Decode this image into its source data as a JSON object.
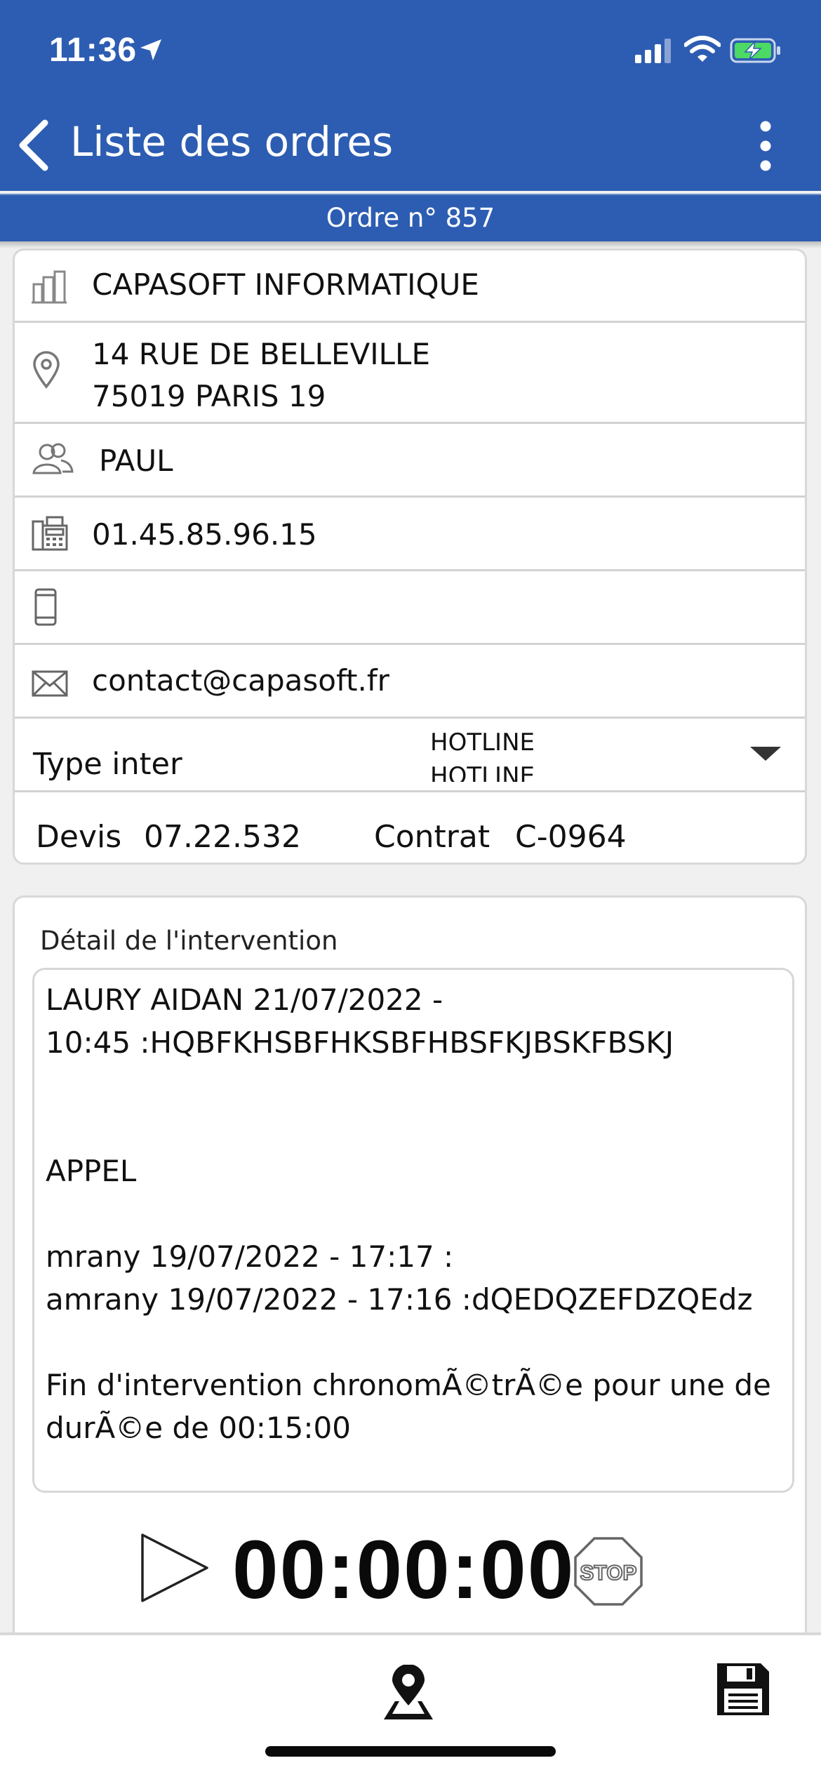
{
  "status_bar": {
    "time": "11:36"
  },
  "nav": {
    "back_label": "Liste des ordres",
    "order_label": "Ordre n° 857"
  },
  "info": {
    "company": "CAPASOFT INFORMATIQUE",
    "address_line1": "14 RUE DE BELLEVILLE",
    "address_line2": "75019 PARIS 19",
    "contact_name": "PAUL",
    "phone": "01.45.85.96.15",
    "mobile": "",
    "email": "contact@capasoft.fr",
    "type_label": "Type inter",
    "type_options": [
      "HOTLINE",
      "HOTLINE"
    ],
    "devis_label": "Devis",
    "devis_value": "07.22.532",
    "contrat_label": "Contrat",
    "contrat_value": "C-0964"
  },
  "detail": {
    "label": "Détail de l'intervention",
    "text": "LAURY AIDAN 21/07/2022 -\n10:45 :HQBFKHSBFHKSBFHBSFKJBSKFBSKJ\n\n\nAPPEL\n\nmrany 19/07/2022 - 17:17 :\namrany 19/07/2022 - 17:16 :dQEDQZEFDZQEdz\n\nFin d'intervention chronomÃ©trÃ©e pour une de\ndurÃ©e de 00:15:00",
    "timer": "00:00:00",
    "stop_label": "STOP"
  },
  "colors": {
    "header": "#2d5db2",
    "background": "#f0f0f1"
  },
  "icons": [
    "location-arrow-icon",
    "signal-icon",
    "wifi-icon",
    "battery-charging-icon",
    "back-chevron-icon",
    "more-vertical-icon",
    "building-icon",
    "map-pin-icon",
    "people-icon",
    "phone-fax-icon",
    "mobile-phone-icon",
    "envelope-icon",
    "dropdown-caret-icon",
    "play-icon",
    "stop-sign-icon",
    "map-marker-icon",
    "save-disk-icon"
  ]
}
